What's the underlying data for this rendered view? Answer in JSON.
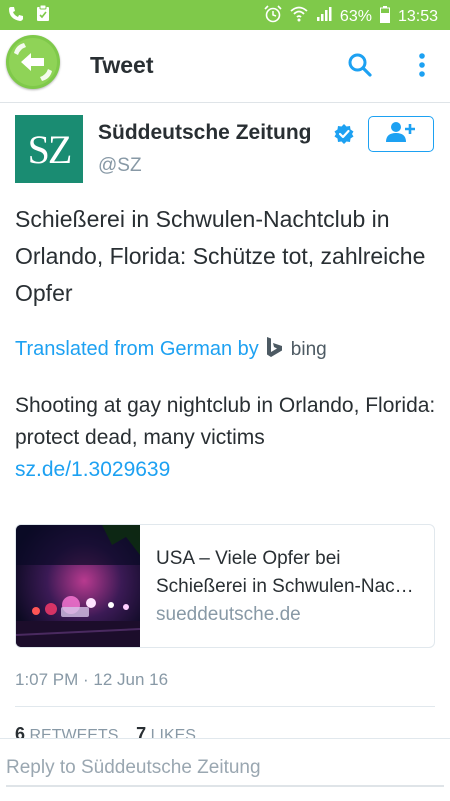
{
  "status_bar": {
    "battery": "63%",
    "time": "13:53",
    "icons": [
      "phone-icon",
      "clipboard-icon",
      "alarm-icon",
      "wifi-icon",
      "signal-icon",
      "battery-icon"
    ]
  },
  "toolbar": {
    "title": "Tweet",
    "back_icon": "back-arrow-icon",
    "search_icon": "search-icon",
    "more_icon": "more-vertical-icon"
  },
  "author": {
    "avatar_text": "SZ",
    "display_name": "Süddeutsche Zeitung",
    "handle": "@SZ",
    "verified_icon": "verified-badge-icon",
    "follow_icon": "add-user-icon"
  },
  "tweet": {
    "text": "Schießerei in Schwulen-Nachtclub in Orlando, Florida: Schütze tot, zahlreiche Opfer",
    "translated_label": "Translated from German by",
    "translator": "bing",
    "translation_text": "Shooting at gay nightclub in Orlando, Florida: protect dead, many victims",
    "translation_link": "sz.de/1.3029639"
  },
  "card": {
    "title_line1": "USA – Viele Opfer bei",
    "title_line2": "Schießerei in Schwulen-Nachtclub",
    "domain": "sueddeutsche.de"
  },
  "timestamp": "1:07 PM · 12 Jun 16",
  "stats": {
    "retweets_count": "6",
    "retweets_label": "RETWEETS",
    "likes_count": "7",
    "likes_label": "LIKES"
  },
  "reply": {
    "placeholder": "Reply to Süddeutsche Zeitung",
    "value": ""
  },
  "colors": {
    "status_bar": "#7fc94a",
    "accent": "#1da1f2",
    "avatar": "#1a8c72",
    "text": "#292f33",
    "muted": "#8899a6"
  }
}
